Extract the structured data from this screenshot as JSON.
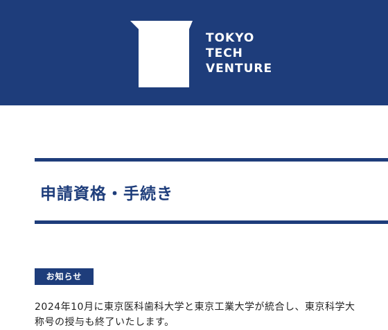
{
  "header": {
    "logo_lines": [
      "TOKYO",
      "TECH",
      "VENTURE"
    ],
    "background_color": "#1e3d7b",
    "logo_icon": "pillar-logo-icon"
  },
  "main": {
    "page_title": "申請資格・手続き",
    "accent_color": "#1e3d7b"
  },
  "notice": {
    "badge_label": "お知らせ",
    "line1": "2024年10月に東京医科歯科大学と東京工業大学が統合し、東京科学大",
    "line2": "称号の授与も終了いたします。"
  }
}
